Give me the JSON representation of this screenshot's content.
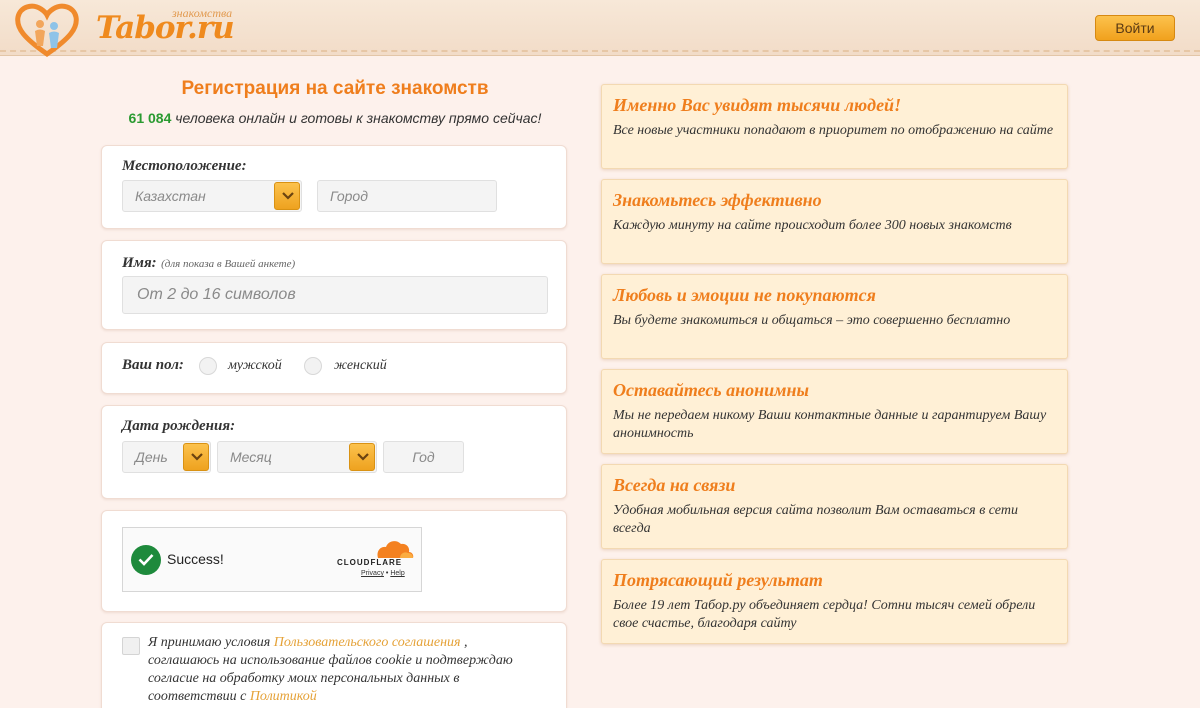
{
  "header": {
    "logo_text": "Tabor.ru",
    "logo_sub": "знакомства",
    "login_label": "Войти",
    "colors": {
      "accent": "#ef8a1e",
      "button": "#f4a623",
      "success": "#2a9a31"
    }
  },
  "registration": {
    "title": "Регистрация на сайте знакомств",
    "online_count": "61 084",
    "online_text": "человека онлайн и готовы к знакомству прямо сейчас!",
    "location": {
      "label": "Местоположение:",
      "country_value": "Казахстан",
      "city_placeholder": "Город"
    },
    "name": {
      "label": "Имя:",
      "note": "(для показа в Вашей анкете)",
      "placeholder": "От 2 до 16 символов"
    },
    "gender": {
      "label": "Ваш пол:",
      "male": "мужской",
      "female": "женский"
    },
    "birthdate": {
      "label": "Дата рождения:",
      "day": "День",
      "month": "Месяц",
      "year": "Год"
    },
    "captcha": {
      "status": "Success!",
      "brand": "CLOUDFLARE",
      "privacy": "Privacy",
      "separator": "•",
      "help": "Help"
    },
    "terms": {
      "text1": "Я принимаю условия",
      "link1": "Пользовательского соглашения",
      "text2": ", соглашаюсь на использование файлов cookie и подтверждаю согласие на обработку моих персональных данных в соответствии с",
      "link2": "Политикой"
    }
  },
  "benefits": [
    {
      "title": "Именно Вас увидят тысячи людей!",
      "text": "Все новые участники попадают в приоритет по отображению на сайте"
    },
    {
      "title": "Знакомьтесь эффективно",
      "text": "Каждую минуту на сайте происходит более 300 новых знакомств"
    },
    {
      "title": "Любовь и эмоции не покупаются",
      "text": "Вы будете знакомиться и общаться – это совершенно бесплатно"
    },
    {
      "title": "Оставайтесь анонимны",
      "text": "Мы не передаем никому Ваши контактные данные и гарантируем Вашу анонимность"
    },
    {
      "title": "Всегда на связи",
      "text": "Удобная мобильная версия сайта позволит Вам оставаться в сети всегда"
    },
    {
      "title": "Потрясающий результат",
      "text": "Более 19 лет Табор.ру объединяет сердца! Сотни тысяч семей обрели свое счастье, благодаря сайту"
    }
  ]
}
